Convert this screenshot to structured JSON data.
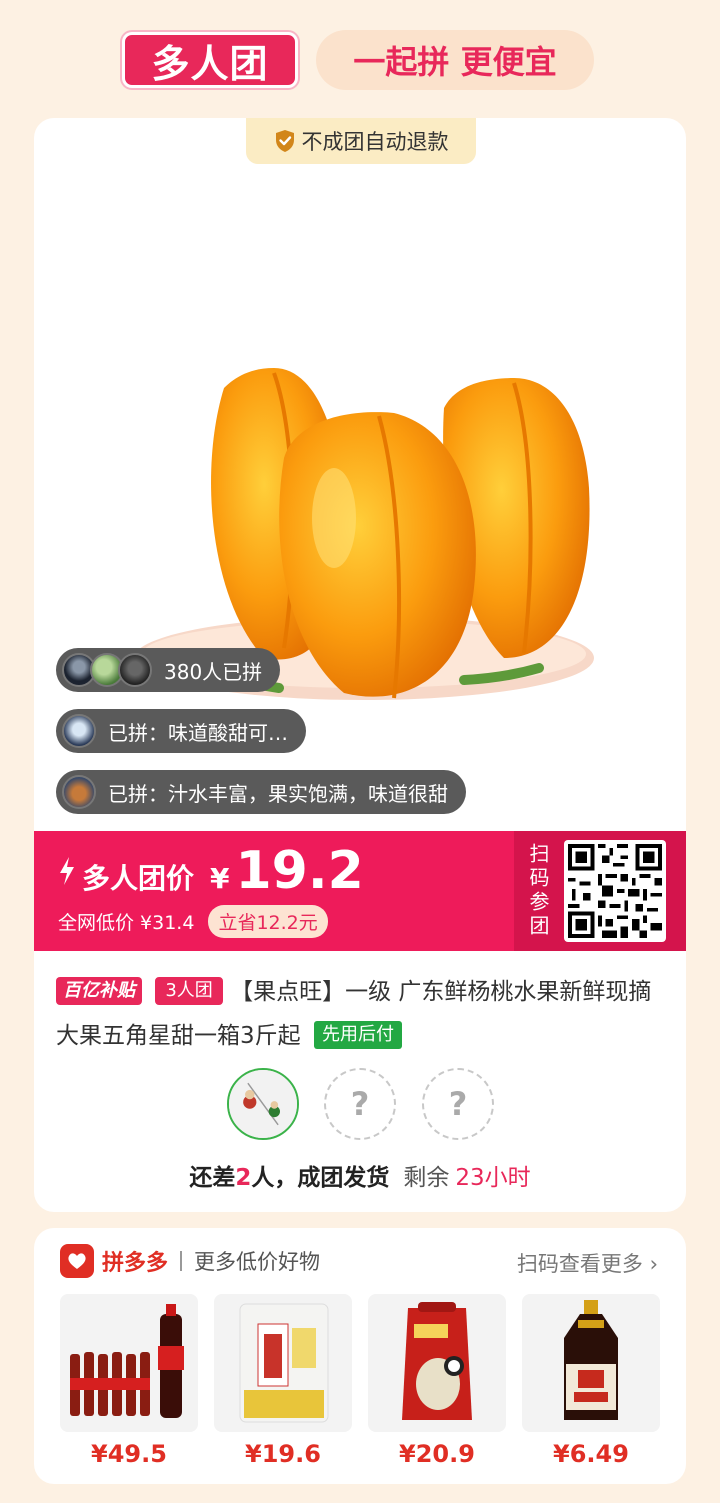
{
  "header": {
    "logo_text": "多人团",
    "slogan": "一起拼 更便宜"
  },
  "refund_tag": "不成团自动退款",
  "social": {
    "joined_count": "380人已拼",
    "review_1": "已拼：味道酸甜可…",
    "review_2": "已拼：汁水丰富，果实饱满，味道很甜"
  },
  "price_bar": {
    "label": "多人团价",
    "currency": "¥",
    "price": "19.2",
    "orig_price": "全网低价 ¥31.4",
    "save": "立省12.2元",
    "scan_text": "扫码参团"
  },
  "product": {
    "tag_subsidy": "百亿补贴",
    "tag_group": "3人团",
    "title": "【果点旺】一级 广东鲜杨桃水果新鲜现摘大果五角星甜一箱3斤起",
    "tag_paylater": "先用后付"
  },
  "group_status": {
    "prefix": "还差",
    "num": "2",
    "suffix": "人，成团发货",
    "remain_label": "剩余",
    "remain_time": "23小时",
    "empty_slot": "?"
  },
  "more": {
    "brand": "拼多多",
    "subtitle": "更多低价好物",
    "link": "扫码查看更多 ›",
    "goods": [
      {
        "price": "¥49.5"
      },
      {
        "price": "¥19.6"
      },
      {
        "price": "¥20.9"
      },
      {
        "price": "¥6.49"
      }
    ]
  },
  "colors": {
    "accent": "#ee1b5a",
    "background": "#fdf1e3",
    "green": "#23a843"
  }
}
